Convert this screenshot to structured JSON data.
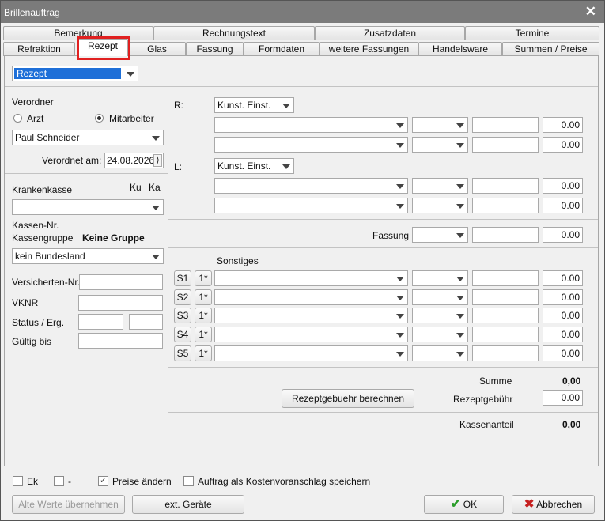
{
  "window": {
    "title": "Brillenauftrag",
    "close_glyph": "✕"
  },
  "tabs_row1": [
    "Bemerkung",
    "Rechnungstext",
    "Zusatzdaten",
    "Termine"
  ],
  "tabs_row2": [
    "Refraktion",
    "Rezept",
    "Glas",
    "Fassung",
    "Formdaten",
    "weitere Fassungen",
    "Handelsware",
    "Summen / Preise"
  ],
  "active_tab": "Rezept",
  "mode_select": {
    "value": "Rezept"
  },
  "left": {
    "verordner_label": "Verordner",
    "radio_arzt": "Arzt",
    "radio_mitarbeiter": "Mitarbeiter",
    "radio_selected": "Mitarbeiter",
    "employee_value": "Paul Schneider",
    "verordnet_label": "Verordnet am:",
    "verordnet_value": "24.08.2026",
    "krankenkasse_label": "Krankenkasse",
    "ku_label": "Ku",
    "ka_label": "Ka",
    "kassen_nr_label": "Kassen-Nr.",
    "kassengruppe_label": "Kassengruppe",
    "kassengruppe_value": "Keine Gruppe",
    "bundesland_value": "kein Bundesland",
    "versicherten_label": "Versicherten-Nr.",
    "vknr_label": "VKNR",
    "status_label": "Status / Erg.",
    "gueltig_label": "Gültig bis"
  },
  "right": {
    "r_label": "R:",
    "l_label": "L:",
    "r_type": "Kunst. Einst.",
    "l_type": "Kunst. Einst.",
    "r_rows": [
      {
        "price": "0.00"
      },
      {
        "price": "0.00"
      }
    ],
    "l_rows": [
      {
        "price": "0.00"
      },
      {
        "price": "0.00"
      }
    ],
    "fassung_label": "Fassung",
    "fassung_price": "0.00",
    "sonstiges_label": "Sonstiges",
    "sonstiges": [
      {
        "code": "S1",
        "qty": "1*",
        "price": "0.00"
      },
      {
        "code": "S2",
        "qty": "1*",
        "price": "0.00"
      },
      {
        "code": "S3",
        "qty": "1*",
        "price": "0.00"
      },
      {
        "code": "S4",
        "qty": "1*",
        "price": "0.00"
      },
      {
        "code": "S5",
        "qty": "1*",
        "price": "0.00"
      }
    ],
    "summe_label": "Summe",
    "summe_value": "0,00",
    "calc_button": "Rezeptgebuehr berechnen",
    "rezeptgebuehr_label": "Rezeptgebühr",
    "rezeptgebuehr_value": "0.00",
    "kassenanteil_label": "Kassenanteil",
    "kassenanteil_value": "0,00"
  },
  "bottom": {
    "ek_label": "Ek",
    "dash_label": "-",
    "preise_label": "Preise ändern",
    "preise_checked": true,
    "kv_label": "Auftrag als Kostenvoranschlag speichern",
    "alte_werte": "Alte Werte übernehmen",
    "ext_geraete": "ext. Geräte",
    "ok": "OK",
    "abbrechen": "Abbrechen"
  },
  "colors": {
    "selection": "#1e6fd8",
    "highlight": "#e02020",
    "ok_check": "#2a9d2a",
    "cancel_x": "#c62020"
  }
}
